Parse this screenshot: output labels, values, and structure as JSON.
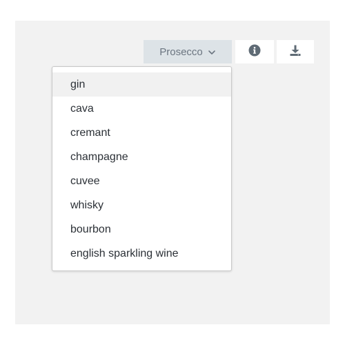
{
  "selector": {
    "selected_label": "Prosecco",
    "icon": "chevron-down-icon"
  },
  "toolbar": {
    "info_icon": "info-icon",
    "download_icon": "download-icon"
  },
  "dropdown": {
    "items": [
      {
        "label": "gin"
      },
      {
        "label": "cava"
      },
      {
        "label": "cremant"
      },
      {
        "label": "champagne"
      },
      {
        "label": "cuvee"
      },
      {
        "label": "whisky"
      },
      {
        "label": "bourbon"
      },
      {
        "label": "english sparkling wine"
      }
    ],
    "highlighted_index": 0
  },
  "colors": {
    "panel_bg": "#f2f2f2",
    "selector_bg": "#dde3e7",
    "selector_text": "#6b7580",
    "icon_color": "#5f6b75",
    "item_hover_bg": "#f1f1f1"
  }
}
